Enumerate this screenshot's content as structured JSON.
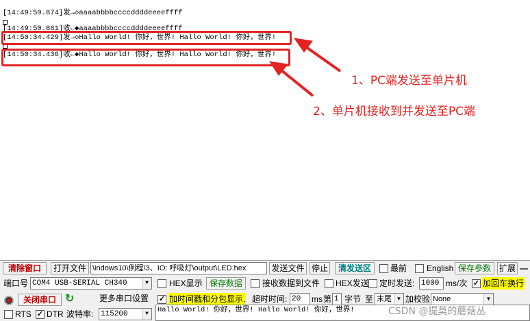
{
  "receive": {
    "lines": [
      "[14:49:50.874]发→◇aaaabbbbccccddddeeeeffff",
      "[14:49:50.881]收←◆aaaabbbbccccddddeeeeffff",
      "[14:50:34.429]发→◇Hallo World! 你好，世界! Hallo World! 你好，世界!",
      "[14:50:34.436]收←◆Hallo World! 你好，世界! Hallo World! 你好，世界!"
    ]
  },
  "annotations": [
    "1、PC端发送至单片机",
    "2、单片机接收到并发送至PC端"
  ],
  "toolbar1": {
    "clear_window": "清除窗口",
    "open_file": "打开文件",
    "file_path": "\\indows10\\例程\\3、IO: 呼吸灯\\output\\LED.hex",
    "send_file": "发送文件",
    "stop": "停止",
    "clear_send": "清发送区",
    "front": "最前",
    "english": "English",
    "save_params": "保存参数",
    "expand": "扩展",
    "minus": "—"
  },
  "toolbar2": {
    "port_label": "端口号",
    "port_value": "COM4 USB-SERIAL CH340",
    "hex_display": "HEX显示",
    "save_data": "保存数据",
    "receive_to_file": "接收数据到文件",
    "hex_send": "HEX发送",
    "timed_send": "定时发送:",
    "interval": "1000",
    "interval_unit": "ms/次",
    "crlf": "加回车换行"
  },
  "toolbar3": {
    "close_port": "关闭串口",
    "more_settings": "更多串口设置",
    "timestamp": "加时间戳和分包显示,",
    "timeout_label": "超时时间:",
    "timeout": "20",
    "timeout_unit": "ms",
    "nth": "第",
    "byte_index": "1",
    "byte_label": "字节",
    "to": "至",
    "end": "末尾",
    "checksum_label": "加校验",
    "checksum": "None"
  },
  "toolbar4": {
    "rts": "RTS",
    "dtr": "DTR",
    "baud_label": "波特率:",
    "baud": "115200"
  },
  "send_text": "Hallo World! 你好，世界! Hallo World! 你好，世界!",
  "watermark": "CSDN @提莫的蘑菇丛",
  "colors": {
    "annotation": "#e32222",
    "highlight": "#ffff00",
    "accent_red": "#c00000",
    "accent_green": "#007a00"
  }
}
